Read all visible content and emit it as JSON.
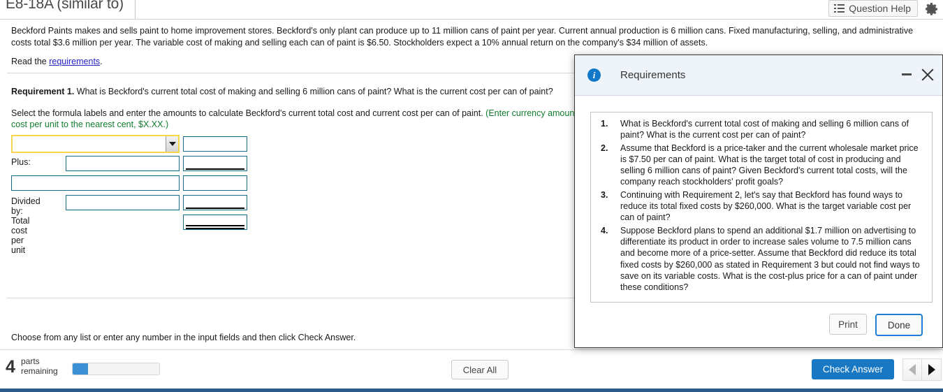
{
  "header": {
    "title": "E8-18A (similar to)",
    "question_help_label": "Question Help",
    "question_help_icon": "list-icon",
    "settings_icon": "gear-icon"
  },
  "problem": {
    "body": "Beckford Paints makes and sells paint to home improvement stores. Beckford's only plant can produce up to 11 million cans of paint per year. Current annual production is 6 million cans. Fixed manufacturing, selling, and administrative costs total $3.6 million per year. The variable cost of making and selling each can of paint is $6.50. Stockholders expect a 10% annual return on the company's $34 million of assets.",
    "read_prefix": "Read the ",
    "read_link": "requirements",
    "read_suffix": ".",
    "requirement_label": "Requirement 1.",
    "requirement_text": " What is Beckford's current total cost of making and selling 6 million cans of paint? What is the current cost per can of paint?",
    "instruction_black": "Select the formula labels and enter the amounts to calculate Beckford's current total cost and current cost per can of paint. ",
    "instruction_green": "(Enter currency amounts in whole dollars. Round all currency amounts to the nearest whole dollar and round the cost per unit to the nearest cent, $X.XX.)"
  },
  "form": {
    "rows": [
      {
        "label": "",
        "type": "select",
        "value": "",
        "amount": ""
      },
      {
        "label": "Plus:",
        "type": "input",
        "value": "",
        "amount": ""
      },
      {
        "label": "",
        "type": "input-full",
        "value": "",
        "amount": ""
      },
      {
        "label": "Divided by:",
        "type": "input",
        "value": "",
        "amount": ""
      },
      {
        "label": "Total cost per unit",
        "type": "label-only",
        "value": "",
        "amount": ""
      }
    ]
  },
  "footer": {
    "choose_text": "Choose from any list or enter any number in the input fields and then click Check Answer.",
    "parts_count": "4",
    "parts_label_line1": "parts",
    "parts_label_line2": "remaining",
    "progress_percent": 18,
    "clear_all_label": "Clear All",
    "check_answer_label": "Check Answer",
    "prev_icon": "triangle-left-icon",
    "next_icon": "triangle-right-icon"
  },
  "dialog": {
    "title": "Requirements",
    "info_icon": "info-icon",
    "info_glyph": "i",
    "minimize_icon": "minimize-icon",
    "close_icon": "close-icon",
    "items": [
      {
        "num": "1.",
        "text": "What is Beckford's current total cost of making and selling 6 million cans of paint? What is the current cost per can of paint?"
      },
      {
        "num": "2.",
        "text": "Assume that Beckford is a price-taker and the current wholesale market price is $7.50 per can of paint. What is the target total of cost in producing and selling 6 million cans of paint? Given Beckford's current total costs, will the company reach stockholders' profit goals?"
      },
      {
        "num": "3.",
        "text": "Continuing with Requirement 2, let's say that Beckford has found ways to reduce its total fixed costs by $260,000. What is the target variable cost per can of paint?"
      },
      {
        "num": "4.",
        "text": "Suppose Beckford plans to spend an additional $1.7 million on advertising to differentiate its product in order to increase sales volume to 7.5 million cans and become more of a price-setter. Assume that Beckford did reduce its total fixed costs by $260,000 as stated in Requirement 3 but could not find ways to save on its variable costs. What is the cost-plus price for a can of paint under these conditions?"
      }
    ],
    "print_label": "Print",
    "done_label": "Done"
  },
  "colors": {
    "accent_blue": "#1878c4",
    "field_border": "#1a6a8a",
    "highlight_yellow": "#f5d74e",
    "link_blue": "#2222cc",
    "green_note": "#127c2e"
  }
}
